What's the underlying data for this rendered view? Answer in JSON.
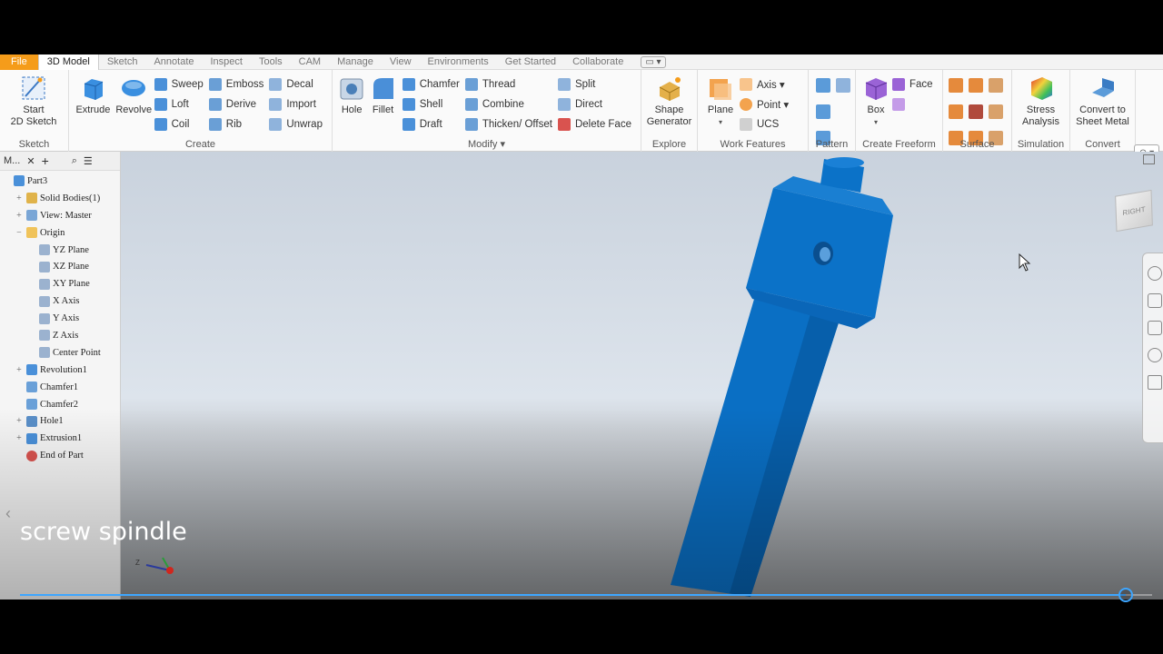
{
  "tabs": [
    "File",
    "3D Model",
    "Sketch",
    "Annotate",
    "Inspect",
    "Tools",
    "CAM",
    "Manage",
    "View",
    "Environments",
    "Get Started",
    "Collaborate"
  ],
  "active_tab": "3D Model",
  "ribbon": {
    "sketch": {
      "start_line1": "Start",
      "start_line2": "2D Sketch",
      "title": "Sketch"
    },
    "create": {
      "extrude": "Extrude",
      "revolve": "Revolve",
      "sweep": "Sweep",
      "loft": "Loft",
      "coil": "Coil",
      "emboss": "Emboss",
      "derive": "Derive",
      "rib": "Rib",
      "decal": "Decal",
      "import": "Import",
      "unwrap": "Unwrap",
      "title": "Create"
    },
    "modify": {
      "hole": "Hole",
      "fillet": "Fillet",
      "chamfer": "Chamfer",
      "shell": "Shell",
      "draft": "Draft",
      "thread": "Thread",
      "combine": "Combine",
      "thicken": "Thicken/ Offset",
      "split": "Split",
      "direct": "Direct",
      "delete_face": "Delete Face",
      "title": "Modify ▾"
    },
    "explore": {
      "shape_line1": "Shape",
      "shape_line2": "Generator",
      "title": "Explore"
    },
    "work_features": {
      "plane": "Plane",
      "axis": "Axis ▾",
      "point": "Point ▾",
      "ucs": "UCS",
      "title": "Work Features"
    },
    "pattern": {
      "title": "Pattern"
    },
    "freeform": {
      "box": "Box",
      "face": "Face",
      "title": "Create Freeform"
    },
    "surface": {
      "title": "Surface"
    },
    "simulation": {
      "line1": "Stress",
      "line2": "Analysis",
      "title": "Simulation"
    },
    "convert": {
      "line1": "Convert to",
      "line2": "Sheet Metal",
      "title": "Convert"
    }
  },
  "browser": {
    "header": "M...",
    "nodes": [
      {
        "label": "Part3",
        "exp": ""
      },
      {
        "label": "Solid Bodies(1)",
        "exp": "+"
      },
      {
        "label": "View: Master",
        "exp": "+"
      },
      {
        "label": "Origin",
        "exp": "−"
      },
      {
        "label": "YZ Plane",
        "exp": ""
      },
      {
        "label": "XZ Plane",
        "exp": ""
      },
      {
        "label": "XY Plane",
        "exp": ""
      },
      {
        "label": "X Axis",
        "exp": ""
      },
      {
        "label": "Y Axis",
        "exp": ""
      },
      {
        "label": "Z Axis",
        "exp": ""
      },
      {
        "label": "Center Point",
        "exp": ""
      },
      {
        "label": "Revolution1",
        "exp": "+"
      },
      {
        "label": "Chamfer1",
        "exp": ""
      },
      {
        "label": "Chamfer2",
        "exp": ""
      },
      {
        "label": "Hole1",
        "exp": "+"
      },
      {
        "label": "Extrusion1",
        "exp": "+"
      },
      {
        "label": "End of Part",
        "exp": ""
      }
    ]
  },
  "viewcube_label": "RIGHT",
  "caption": "screw spindle",
  "video_progress": 0.977,
  "colors": {
    "model_blue": "#0a6fc4",
    "accent_orange": "#f59c1a",
    "progress_blue": "#3ea6ff"
  }
}
